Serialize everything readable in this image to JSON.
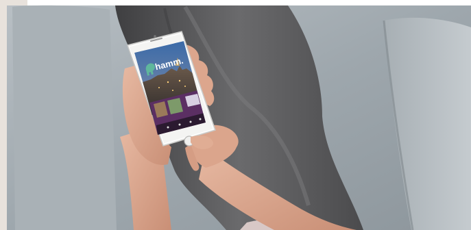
{
  "app_logo": {
    "text": "hamm."
  },
  "colors": {
    "sofa": "#9ea7ad",
    "jeans": "#5a5a5c",
    "skin": "#d9a48b",
    "phone_body": "#f4f4f2",
    "screen_sky": "#2f4f86",
    "screen_brand_purple": "#5b2f63",
    "logo_green": "#5fb79c"
  }
}
